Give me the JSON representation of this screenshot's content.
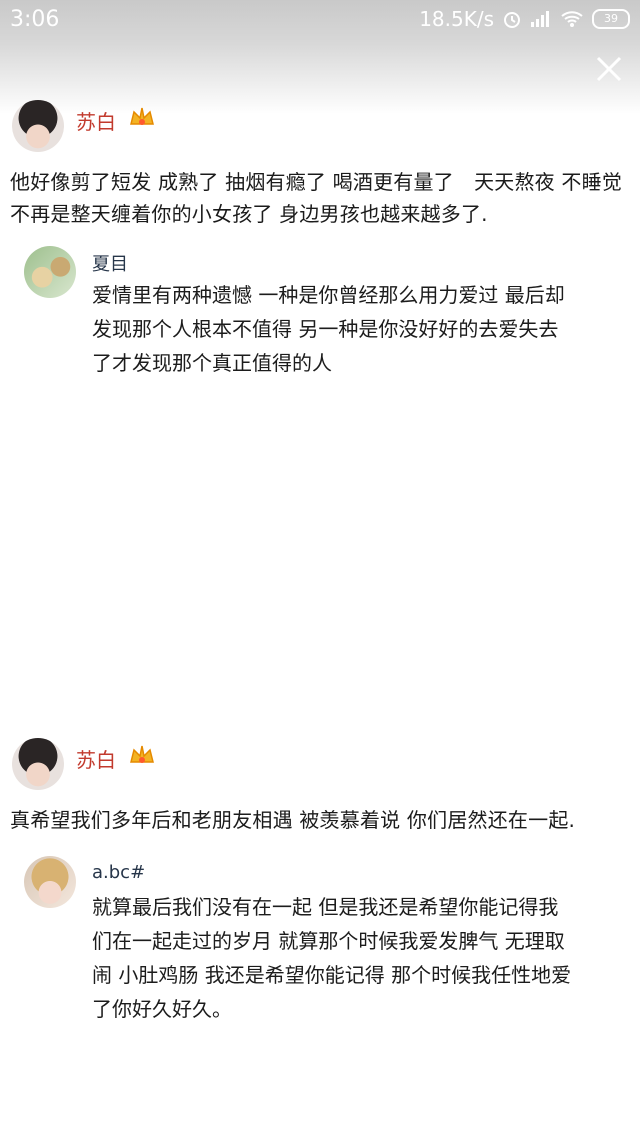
{
  "status_bar": {
    "time": "3:06",
    "network_speed": "18.5K/s",
    "battery_level": "39",
    "icons": [
      "alarm-icon",
      "signal-icon",
      "wifi-icon",
      "battery-icon"
    ]
  },
  "close_icon": "close-icon",
  "posts": [
    {
      "author": "苏白",
      "content": "他好像剪了短发 成熟了 抽烟有瘾了 喝酒更有量了　天天熬夜 不睡觉 不再是整天缠着你的小女孩了 身边男孩也越来越多了.",
      "reply": {
        "name": "夏目",
        "text": "爱情里有两种遗憾 一种是你曾经那么用力爱过 最后却发现那个人根本不值得 另一种是你没好好的去爱失去了才发现那个真正值得的人"
      }
    },
    {
      "author": "苏白",
      "content": "真希望我们多年后和老朋友相遇 被羡慕着说 你们居然还在一起.",
      "reply": {
        "name": "a.bc#",
        "text": "就算最后我们没有在一起 但是我还是希望你能记得我们在一起走过的岁月 就算那个时候我爱发脾气 无理取闹 小肚鸡肠 我还是希望你能记得 那个时候我任性地爱了你好久好久。"
      }
    }
  ],
  "colors": {
    "author": "#c23a2d",
    "reply_name": "#27364a",
    "status_bg": "#cfcfcf"
  }
}
